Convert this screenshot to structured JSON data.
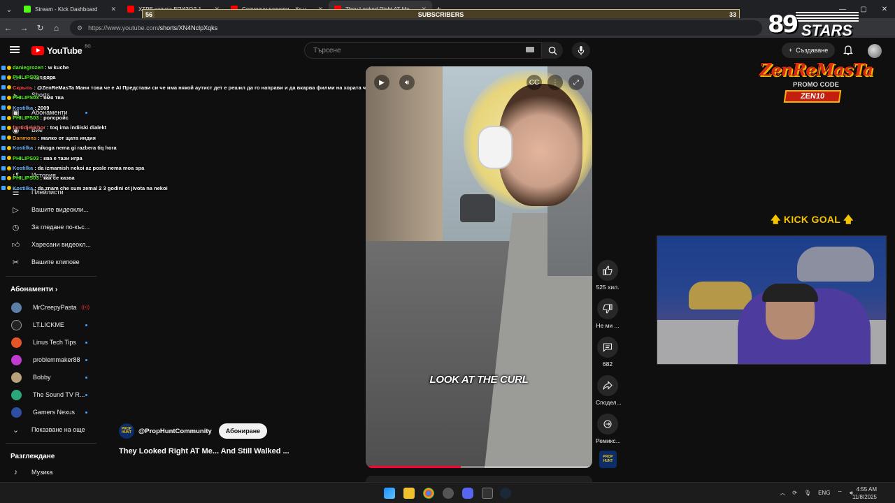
{
  "browser": {
    "tabs": [
      {
        "label": "Stream - Kick Dashboard",
        "color": "#53fc18",
        "active": false
      },
      {
        "label": "ХТРЕ изпита ЕПИЗОД 10 'А...",
        "color": "#ff0000",
        "active": false
      },
      {
        "label": "Сериозни разкови – Кх на с 3...",
        "color": "#ff0000",
        "active": false
      },
      {
        "label": "They Looked Right AT Me...",
        "color": "#ff0000",
        "active": true
      }
    ],
    "url_host": "https://www.youtube.com",
    "url_path": "/shorts/XN4NclpXqks"
  },
  "subscribers_bar": {
    "label": "SUBSCRIBERS",
    "current": "56",
    "goal": "33",
    "fill_fraction": 0.02
  },
  "header": {
    "logo_text": "YouTube",
    "region": "BG",
    "search_placeholder": "Търсене",
    "create_label": "Създаване"
  },
  "sidebar": {
    "items": [
      {
        "label": "Начало",
        "icon": "home-icon",
        "name": "sidebar-item-home"
      },
      {
        "label": "Shorts",
        "icon": "shorts-icon",
        "name": "sidebar-item-shorts"
      },
      {
        "label": "Абонаменти",
        "icon": "subscriptions-icon",
        "name": "sidebar-item-subscriptions"
      },
      {
        "label": "Вие",
        "icon": "user-icon",
        "name": "sidebar-item-you"
      },
      {
        "label": "История",
        "icon": "history-icon",
        "name": "sidebar-item-history"
      },
      {
        "label": "Плейлисти",
        "icon": "playlist-icon",
        "name": "sidebar-item-playlists"
      },
      {
        "label": "Вашите видеоклипове",
        "display": "Вашите видеокли...",
        "icon": "video-icon",
        "name": "sidebar-item-your-videos"
      },
      {
        "label": "За гледане по-късно",
        "display": "За гледане по-къс...",
        "icon": "clock-icon",
        "name": "sidebar-item-watch-later"
      },
      {
        "label": "Харесани видеоклипове",
        "display": "Харесани видеокл...",
        "icon": "thumb-up-icon",
        "name": "sidebar-item-liked"
      },
      {
        "label": "Вашите клипове",
        "icon": "scissors-icon",
        "name": "sidebar-item-clips"
      }
    ],
    "subscriptions_heading": "Абонаменти",
    "subscriptions": [
      {
        "label": "MrCreepyPasta",
        "color": "#5b7fa8",
        "live": true
      },
      {
        "label": "LT.LICKME",
        "color": "#222222",
        "live": false
      },
      {
        "label": "Linus Tech Tips",
        "color": "#e8542a",
        "live": false
      },
      {
        "label": "problemmaker88",
        "color": "#c23bd1",
        "live": false
      },
      {
        "label": "Bobby",
        "color": "#b7a27c",
        "live": false
      },
      {
        "label": "The Sound TV R...",
        "color": "#2aa879",
        "live": false
      },
      {
        "label": "Gamers Nexus",
        "color": "#2c4fa3",
        "live": false
      }
    ],
    "show_more": "Показване на още",
    "explore_heading": "Разглеждане",
    "explore_items": [
      {
        "label": "Музика",
        "icon": "music-note-icon"
      }
    ]
  },
  "chat": [
    {
      "user": "daniegrozen",
      "color": "#53fc18",
      "text": ": w kuche"
    },
    {
      "user": "PHILIPS03",
      "color": "#53fc18",
      "text": ": сора"
    },
    {
      "user": "Скрыть",
      "color": "#ff4b4b",
      "text": ": @ZenReMasTa Мани това че е AI Представи си че има някой аутист дет е решил да го направи и да вкарва филми на хората че е истина"
    },
    {
      "user": "PHILIPS03",
      "color": "#53fc18",
      "text": ": бмя тва"
    },
    {
      "user": "Kostilka",
      "color": "#6fb7ff",
      "text": ": 2009"
    },
    {
      "user": "PHILIPS03",
      "color": "#53fc18",
      "text": ": ролсройс"
    },
    {
      "user": "fantidjekkhor",
      "color": "#ff6b6b",
      "text": ": toq ima indiiski dialekt"
    },
    {
      "user": "Danmons",
      "color": "#f59a23",
      "text": ": малко от щата индия"
    },
    {
      "user": "Kostilka",
      "color": "#6fb7ff",
      "text": ": nikoga nema gi razbera tiq hora"
    },
    {
      "user": "PHILIPS03",
      "color": "#53fc18",
      "text": ": ква е тази игра"
    },
    {
      "user": "Kostilka",
      "color": "#6fb7ff",
      "text": ": da izmamish nekoi az posle nema moa spa"
    },
    {
      "user": "PHILIPS03",
      "color": "#53fc18",
      "text": ": как се казва"
    },
    {
      "user": "Kostilka",
      "color": "#6fb7ff",
      "text": ": da znam che sum zemal 2 3 godini ot jivota na nekoi"
    }
  ],
  "video": {
    "caption": "LOOK AT THE CURL",
    "progress_fraction": 0.42,
    "channel": "@PropHuntCommunity",
    "channel_avatar_text": "PROP HUNT",
    "subscribe_label": "Абониране",
    "title": "They Looked Right AT Me... And Still Walked ..."
  },
  "actions": [
    {
      "label": "525 хил.",
      "icon": "thumb-up-icon",
      "name": "like-button"
    },
    {
      "label": "Не ми ...",
      "icon": "thumb-down-icon",
      "name": "dislike-button"
    },
    {
      "label": "682",
      "icon": "comment-icon",
      "name": "comments-button"
    },
    {
      "label": "Сподел...",
      "icon": "share-icon",
      "name": "share-button"
    },
    {
      "label": "Ремикс...",
      "icon": "remix-icon",
      "name": "remix-button"
    }
  ],
  "overlays": {
    "stars_number": "89",
    "stars_word": "STARS",
    "zen_name": "ZenReMasTa",
    "promo_label": "PROMO CODE",
    "promo_code": "ZEN10",
    "kick_goal": "KICK GOAL"
  },
  "taskbar": {
    "lang": "ENG",
    "time": "4:55 AM",
    "date": "11/8/2025"
  }
}
